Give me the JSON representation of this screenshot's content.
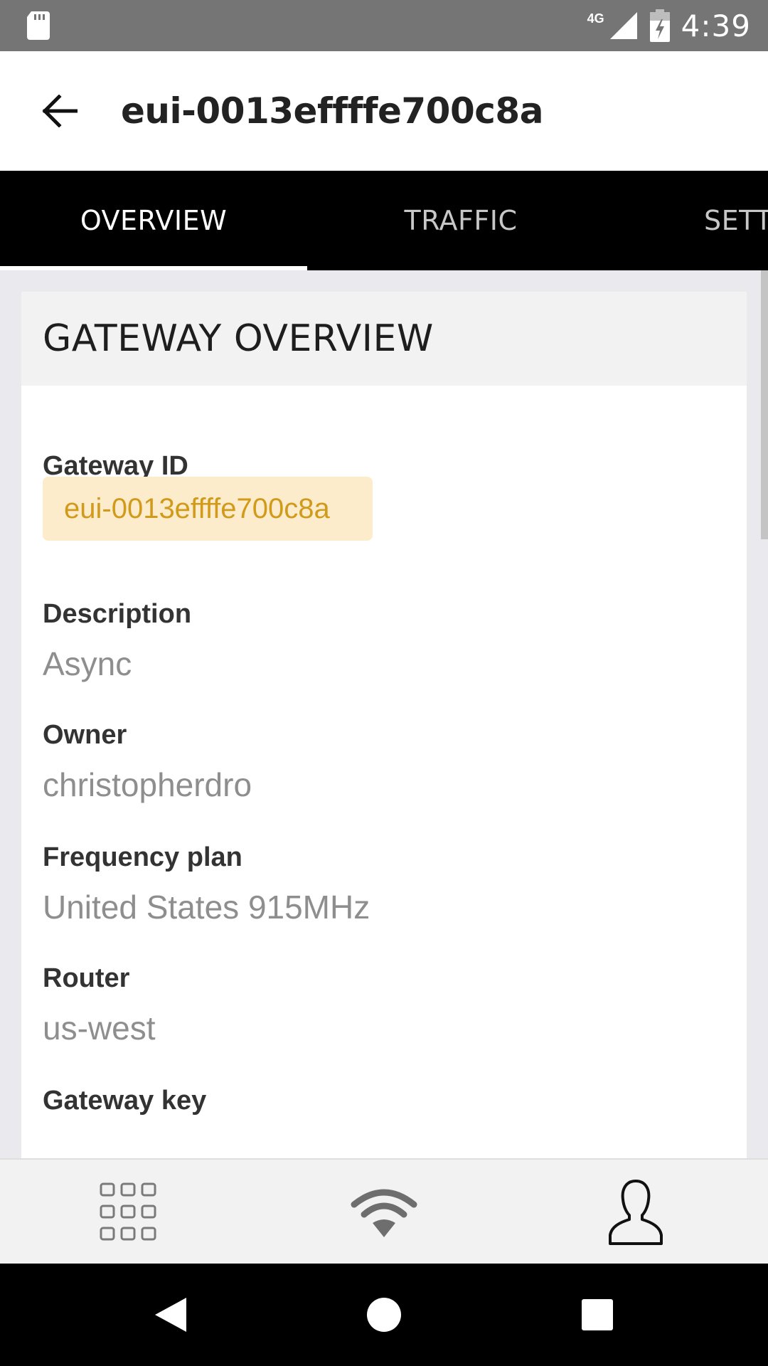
{
  "status_bar": {
    "time": "4:39",
    "network": "4G",
    "icons": [
      "sd-card-icon",
      "signal-icon",
      "battery-charging-icon"
    ]
  },
  "header": {
    "title": "eui-0013effffe700c8a",
    "back_icon": "arrow-left-icon"
  },
  "tabs": [
    {
      "label": "OVERVIEW",
      "active": true
    },
    {
      "label": "TRAFFIC",
      "active": false
    },
    {
      "label": "SETT",
      "active": false
    }
  ],
  "card": {
    "title": "GATEWAY OVERVIEW",
    "fields": {
      "gateway_id": {
        "label": "Gateway ID",
        "value": "eui-0013effffe700c8a"
      },
      "description": {
        "label": "Description",
        "value": "Async"
      },
      "owner": {
        "label": "Owner",
        "value": "christopherdro"
      },
      "frequency_plan": {
        "label": "Frequency plan",
        "value": "United States 915MHz"
      },
      "router": {
        "label": "Router",
        "value": "us-west"
      },
      "gateway_key": {
        "label": "Gateway key"
      }
    }
  },
  "bottom_nav": [
    "grid-apps-icon",
    "wifi-icon",
    "user-profile-icon"
  ],
  "system_nav": [
    "back-triangle-icon",
    "home-circle-icon",
    "recents-square-icon"
  ],
  "colors": {
    "status_bar": "#757575",
    "tab_bar": "#000000",
    "id_chip_bg": "#fdeccb",
    "id_chip_text": "#d19a1a",
    "value_text": "#8e8e8e"
  }
}
